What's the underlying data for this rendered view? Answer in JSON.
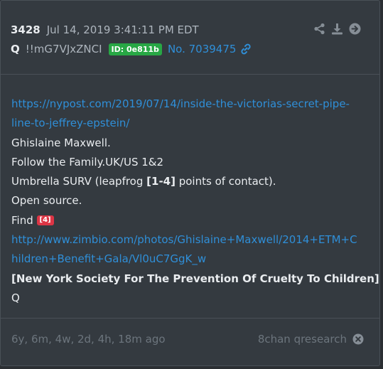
{
  "post": {
    "number": "3428",
    "date": "Jul 14, 2019 3:41:11 PM EDT",
    "author": "Q",
    "tripcode": "!!mG7VJxZNCI",
    "id_badge": "ID: 0e811b",
    "post_link": "No. 7039475"
  },
  "actions": [
    "share-icon",
    "download-icon",
    "arrow-right-circle-icon"
  ],
  "body": {
    "url1_line1": "https://nypost.com/2019/07/14/inside-the-victorias-secret-pipe-",
    "url1_line2": "line-to-jeffrey-epstein/",
    "line3": "Ghislaine Maxwell.",
    "line4": "Follow the Family.UK/US 1&2",
    "line5_pre": "Umbrella SURV (leapfrog ",
    "line5_bold": "[1-4]",
    "line5_post": " points of contact).",
    "line6": "Open source.",
    "line7_pre": "Find ",
    "line7_badge": "[4]",
    "url2_line1": "http://www.zimbio.com/photos/Ghislaine+Maxwell/2014+ETM+C",
    "url2_line2": "hildren+Benefit+Gala/Vl0uC7GgK_w",
    "line10": "[New York Society For The Prevention Of Cruelty To Children]",
    "line11": "Q"
  },
  "footer": {
    "timeago": "6y, 6m, 4w, 2d, 4h, 18m ago",
    "source": "8chan qresearch"
  },
  "colors": {
    "link": "#2f8fd8",
    "id_badge": "#28a745",
    "ref_badge": "#dc3545"
  }
}
